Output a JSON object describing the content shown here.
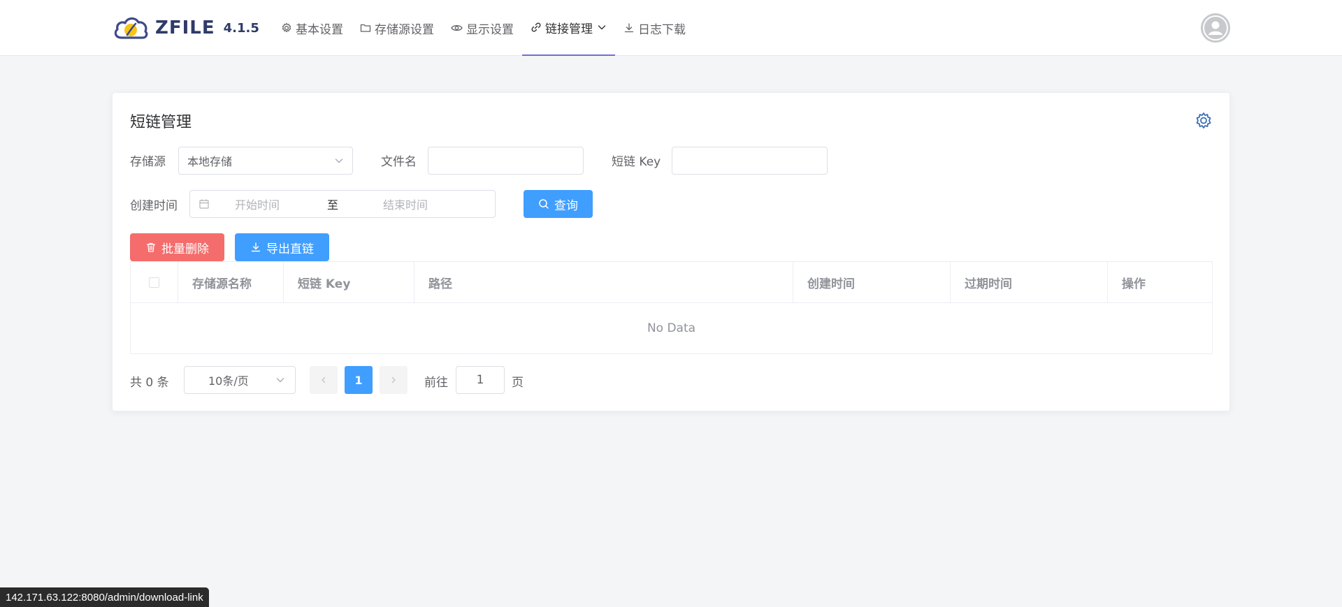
{
  "header": {
    "logo_text": "ZFILE",
    "version": "4.1.5",
    "nav": [
      {
        "label": "基本设置",
        "icon": "gear-icon"
      },
      {
        "label": "存储源设置",
        "icon": "folder-icon"
      },
      {
        "label": "显示设置",
        "icon": "eye-icon"
      },
      {
        "label": "链接管理",
        "icon": "link-icon",
        "active": true
      },
      {
        "label": "日志下载",
        "icon": "download-icon"
      }
    ]
  },
  "card": {
    "title": "短链管理",
    "filters": {
      "storage_label": "存储源",
      "storage_value": "本地存储",
      "filename_label": "文件名",
      "filename_value": "",
      "key_label": "短链 Key",
      "key_value": "",
      "time_label": "创建时间",
      "start_placeholder": "开始时间",
      "range_separator": "至",
      "end_placeholder": "结束时间",
      "query_button": "查询"
    },
    "actions": {
      "batch_delete": "批量删除",
      "export": "导出直链"
    },
    "table": {
      "columns": [
        "存储源名称",
        "短链 Key",
        "路径",
        "创建时间",
        "过期时间",
        "操作"
      ],
      "rows": [],
      "empty_text": "No Data"
    },
    "pagination": {
      "total_text": "共 0 条",
      "page_size": "10条/页",
      "current_page": "1",
      "goto_label": "前往",
      "goto_value": "1",
      "page_unit": "页"
    }
  },
  "status_bar": {
    "url": "142.171.63.122:8080/admin/download-link"
  },
  "colors": {
    "primary": "#409eff",
    "danger": "#f56c6c",
    "nav_active_underline": "#6b6fd6",
    "logo": "#2f3b68"
  }
}
